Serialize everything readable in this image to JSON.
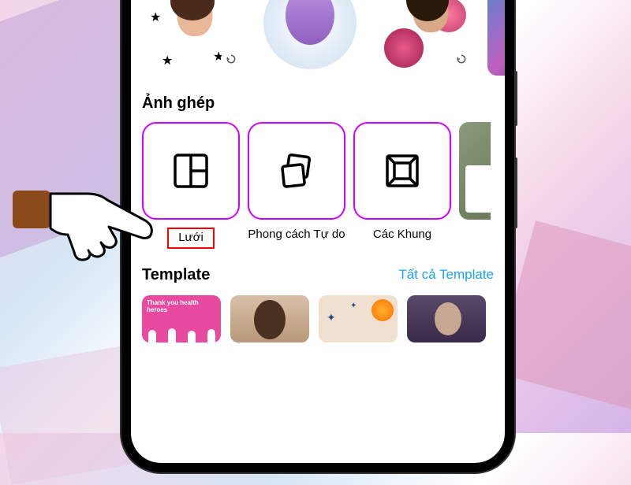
{
  "sections": {
    "collage": {
      "title": "Ảnh ghép"
    },
    "template": {
      "title": "Template",
      "see_all": "Tất cả Template"
    }
  },
  "collage_options": [
    {
      "label": "Lưới",
      "icon": "grid-collage-icon",
      "highlighted": true
    },
    {
      "label": "Phong cách Tự do",
      "icon": "freestyle-icon"
    },
    {
      "label": "Các Khung",
      "icon": "frames-icon"
    }
  ],
  "template_cards": [
    {
      "caption": "Thank you health heroes",
      "bg": "#e84aa0"
    }
  ],
  "colors": {
    "accent": "#d400ff",
    "link": "#1da1f2",
    "highlight_border": "#ff0000"
  }
}
